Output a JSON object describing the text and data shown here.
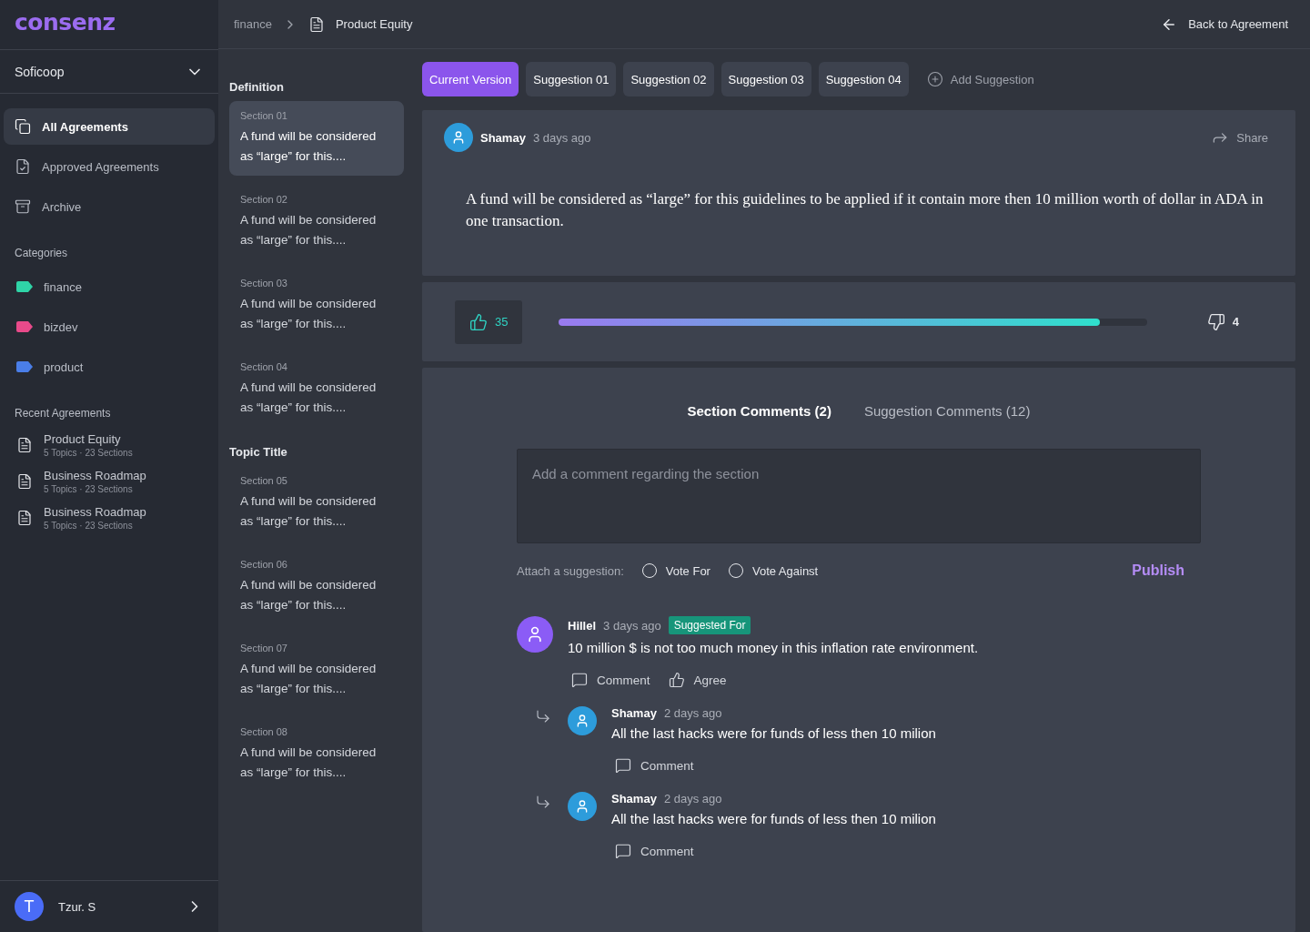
{
  "logo": "consenz",
  "workspace": {
    "name": "Soficoop"
  },
  "nav": [
    {
      "label": "All Agreements",
      "selected": true
    },
    {
      "label": "Approved Agreements",
      "selected": false
    },
    {
      "label": "Archive",
      "selected": false
    }
  ],
  "categories": {
    "title": "Categories",
    "items": [
      {
        "label": "finance",
        "color": "#2fd4a7"
      },
      {
        "label": "bizdev",
        "color": "#e84a8a"
      },
      {
        "label": "product",
        "color": "#4a7ee8"
      }
    ]
  },
  "recent": {
    "title": "Recent Agreements",
    "items": [
      {
        "title": "Product Equity",
        "meta": "5 Topics · 23 Sections"
      },
      {
        "title": "Business Roadmap",
        "meta": "5 Topics · 23 Sections"
      },
      {
        "title": "Business Roadmap",
        "meta": "5 Topics · 23 Sections"
      }
    ]
  },
  "user": {
    "initial": "T",
    "name": "Tzur. S"
  },
  "breadcrumb": {
    "parent": "finance",
    "current": "Product Equity"
  },
  "back_link": "Back to Agreement",
  "topics": [
    {
      "title": "Definition",
      "sections": [
        {
          "label": "Section 01",
          "text": "A fund will be considered as “large” for this....",
          "selected": true
        },
        {
          "label": "Section 02",
          "text": "A fund will be considered as “large” for this....",
          "selected": false
        },
        {
          "label": "Section 03",
          "text": "A fund will be considered as “large” for this....",
          "selected": false
        },
        {
          "label": "Section 04",
          "text": "A fund will be considered as “large” for this....",
          "selected": false
        }
      ]
    },
    {
      "title": "Topic Title",
      "sections": [
        {
          "label": "Section 05",
          "text": "A fund will be considered as “large” for this....",
          "selected": false
        },
        {
          "label": "Section 06",
          "text": "A fund will be considered as “large” for this....",
          "selected": false
        },
        {
          "label": "Section 07",
          "text": "A fund will be considered as “large” for this....",
          "selected": false
        },
        {
          "label": "Section 08",
          "text": "A fund will be considered as “large” for this....",
          "selected": false
        }
      ]
    }
  ],
  "version_tabs": [
    {
      "label": "Current Version",
      "selected": true
    },
    {
      "label": "Suggestion 01",
      "selected": false
    },
    {
      "label": "Suggestion 02",
      "selected": false
    },
    {
      "label": "Suggestion 03",
      "selected": false
    },
    {
      "label": "Suggestion 04",
      "selected": false
    }
  ],
  "add_suggestion": "Add Suggestion",
  "post": {
    "author": "Shamay",
    "time": "3 days ago",
    "share": "Share",
    "text": "A fund will be considered as “large” for this guidelines to be applied if it contain more then 10 million worth of dollar in ADA in one transaction."
  },
  "votes": {
    "up": "35",
    "down": "4",
    "level": 0.92
  },
  "comment_tabs": [
    {
      "label": "Section Comments (2)",
      "selected": true
    },
    {
      "label": "Suggestion Comments (12)",
      "selected": false
    }
  ],
  "comment_input": {
    "placeholder": "Add a comment regarding the section"
  },
  "attach": {
    "label": "Attach a suggestion:",
    "options": [
      {
        "label": "Vote For",
        "checked": false
      },
      {
        "label": "Vote Against",
        "checked": false
      }
    ],
    "publish": "Publish"
  },
  "comments": [
    {
      "author": "Hillel",
      "time": "3 days ago",
      "badge": "Suggested For",
      "color": "#8b5cf6",
      "text": "10 million $ is not too much money in this inflation rate environment.",
      "actions": [
        {
          "kind": "comment",
          "label": "Comment"
        },
        {
          "kind": "agree",
          "label": "Agree"
        }
      ],
      "children": [
        {
          "author": "Shamay",
          "time": "2 days ago",
          "color": "#2d9cdb",
          "text": "All the last hacks were for funds of less then 10 milion",
          "actions": [
            {
              "kind": "comment",
              "label": "Comment"
            }
          ]
        },
        {
          "author": "Shamay",
          "time": "2 days ago",
          "color": "#2d9cdb",
          "text": "All the last hacks were for funds of less then 10 milion",
          "actions": [
            {
              "kind": "comment",
              "label": "Comment"
            }
          ]
        }
      ]
    }
  ]
}
